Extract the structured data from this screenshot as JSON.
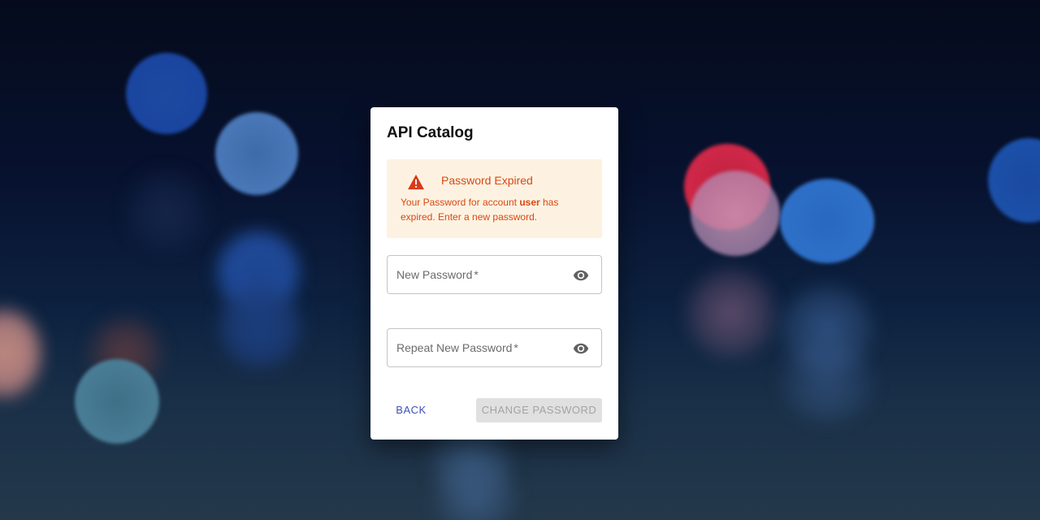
{
  "dialog": {
    "title": "API Catalog"
  },
  "alert": {
    "icon": "warning-icon",
    "color": "#d9480f",
    "background": "#fdf2e2",
    "title": "Password Expired",
    "message_prefix": "Your Password for account ",
    "account": "user",
    "message_suffix": " has expired. Enter a new password."
  },
  "form": {
    "new_password": {
      "label": "New Password",
      "required_marker": "*",
      "value": "",
      "visibility_icon": "eye-icon"
    },
    "repeat_password": {
      "label": "Repeat New Password",
      "required_marker": "*",
      "value": "",
      "visibility_icon": "eye-icon"
    }
  },
  "actions": {
    "back_label": "BACK",
    "change_label": "CHANGE PASSWORD",
    "back_color": "#3f51b5"
  }
}
